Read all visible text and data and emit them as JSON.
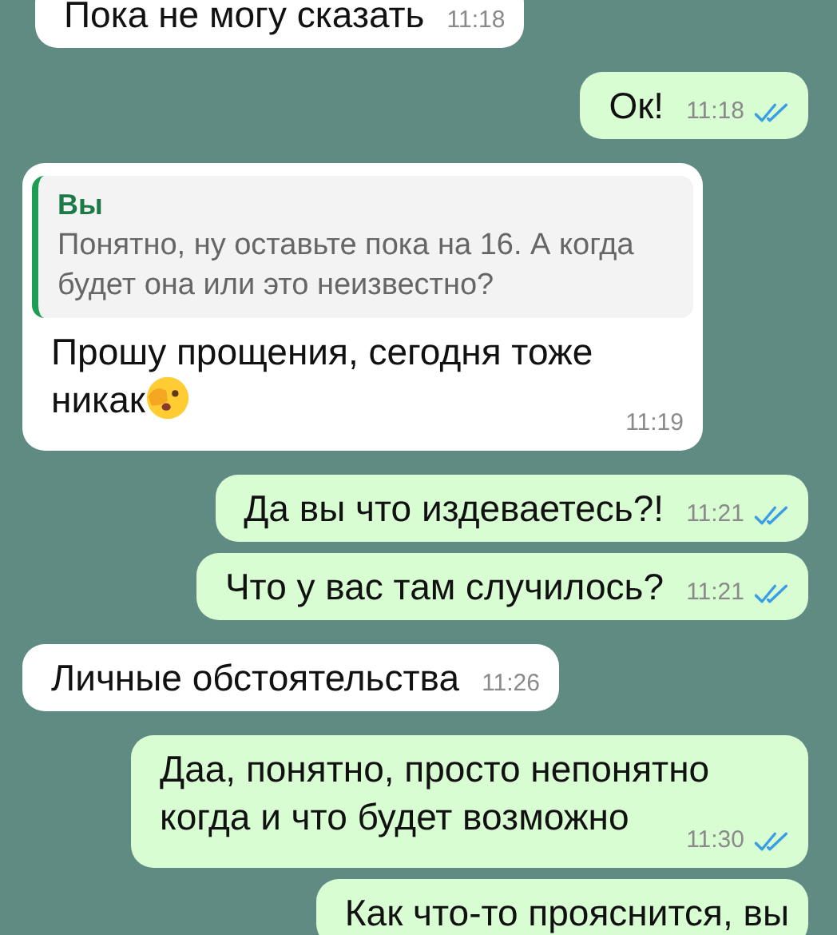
{
  "messages": [
    {
      "outgoing": false,
      "text": "Пока не могу сказать",
      "time": "11:18"
    },
    {
      "outgoing": true,
      "text": "Ок!",
      "time": "11:18",
      "read": true
    },
    {
      "outgoing": false,
      "quote": {
        "author": "Вы",
        "text": "Понятно, ну оставьте пока на 16. А когда будет она или это неизвестно?"
      },
      "text": "Прошу прощения, сегодня тоже никак",
      "emoji": true,
      "time": "11:19"
    },
    {
      "outgoing": true,
      "text": "Да вы что издеваетесь?!",
      "time": "11:21",
      "read": true
    },
    {
      "outgoing": true,
      "text": "Что у вас там случилось?",
      "time": "11:21",
      "read": true
    },
    {
      "outgoing": false,
      "text": "Личные обстоятельства",
      "time": "11:26"
    },
    {
      "outgoing": true,
      "text": "Даа, понятно, просто непонятно когда и что будет возможно",
      "time": "11:30",
      "read": true
    },
    {
      "outgoing": true,
      "text": "Как что-то прояснится, вы"
    }
  ]
}
